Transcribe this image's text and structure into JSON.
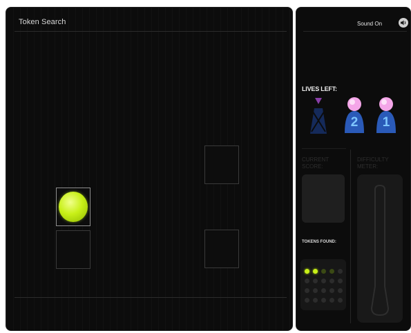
{
  "game": {
    "title": "Token Search",
    "slots": [
      {
        "id": "slot-1",
        "has_token": true
      },
      {
        "id": "slot-2",
        "has_token": false
      },
      {
        "id": "slot-3",
        "has_token": false
      },
      {
        "id": "slot-4",
        "has_token": false
      }
    ]
  },
  "sidebar": {
    "sound_label": "Sound On",
    "sound_icon": "speaker-icon",
    "lives_label": "LIVES LEFT:",
    "lives": [
      {
        "label": "",
        "state": "lost"
      },
      {
        "label": "2",
        "state": "remaining"
      },
      {
        "label": "1",
        "state": "remaining"
      }
    ],
    "current_score_label": "CURRENT SCORE:",
    "difficulty_meter_label": "DIFFICULTY METER:",
    "tokens_found_label": "TOKENS FOUND:",
    "tokens_grid": {
      "rows": 4,
      "cols": 5,
      "found": 2,
      "dim": 2
    }
  },
  "colors": {
    "token": "#c8f018",
    "life_head": "#f4a6e8",
    "life_body": "#2a5ab8",
    "background": "#0c0c0c"
  }
}
